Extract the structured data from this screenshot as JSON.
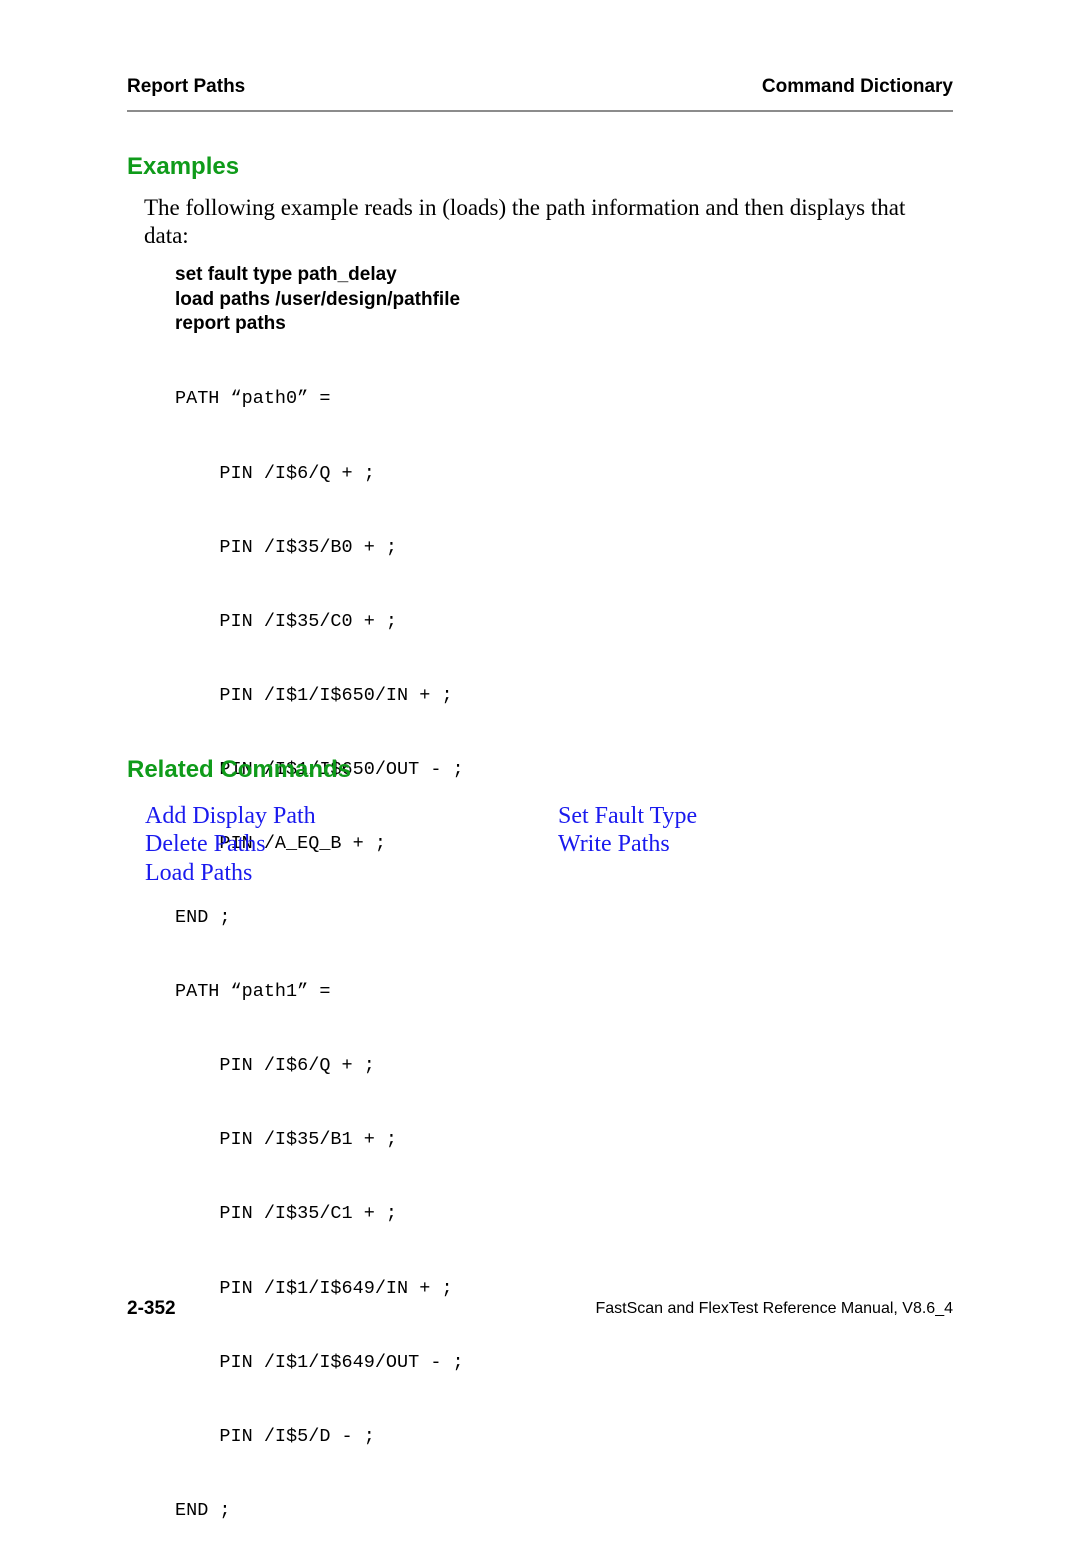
{
  "header": {
    "left": "Report Paths",
    "right": "Command Dictionary"
  },
  "examples": {
    "title": "Examples",
    "intro": "The following example reads in (loads) the path information and then displays that data:",
    "commands": [
      "set fault type path_delay",
      "load paths /user/design/pathfile",
      "report paths"
    ],
    "output_lines": [
      "PATH “path0” =",
      "    PIN /I$6/Q + ;",
      "    PIN /I$35/B0 + ;",
      "    PIN /I$35/C0 + ;",
      "    PIN /I$1/I$650/IN + ;",
      "    PIN /I$1/I$650/OUT - ;",
      "    PIN /A_EQ_B + ;",
      "END ;",
      "PATH “path1” =",
      "    PIN /I$6/Q + ;",
      "    PIN /I$35/B1 + ;",
      "    PIN /I$35/C1 + ;",
      "    PIN /I$1/I$649/IN + ;",
      "    PIN /I$1/I$649/OUT - ;",
      "    PIN /I$5/D - ;",
      "END ;"
    ]
  },
  "related": {
    "title": "Related Commands",
    "left_links": [
      "Add Display Path",
      "Delete Paths",
      "Load Paths"
    ],
    "right_links": [
      "Set Fault Type",
      "Write Paths"
    ]
  },
  "footer": {
    "page_number": "2-352",
    "manual_title": "FastScan and FlexTest Reference Manual, V8.6_4"
  },
  "colors": {
    "heading_green": "#0f9b1a",
    "link_blue": "#1a1aee",
    "rule_gray": "#8c8c8c"
  }
}
